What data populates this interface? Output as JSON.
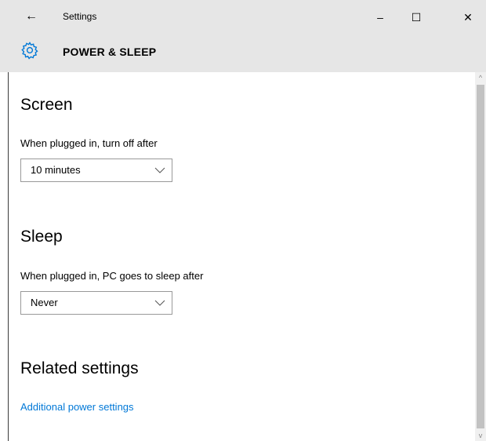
{
  "window": {
    "title": "Settings",
    "back_glyph": "←",
    "minimize_glyph": "–",
    "maximize_glyph": "☐",
    "close_glyph": "✕"
  },
  "header": {
    "icon": "gear-icon",
    "title": "POWER & SLEEP",
    "accent": "#0078d7"
  },
  "screen": {
    "heading": "Screen",
    "label": "When plugged in, turn off after",
    "selected": "10 minutes"
  },
  "sleep": {
    "heading": "Sleep",
    "label": "When plugged in, PC goes to sleep after",
    "selected": "Never"
  },
  "related": {
    "heading": "Related settings",
    "link": "Additional power settings",
    "link_color": "#0078d7"
  }
}
